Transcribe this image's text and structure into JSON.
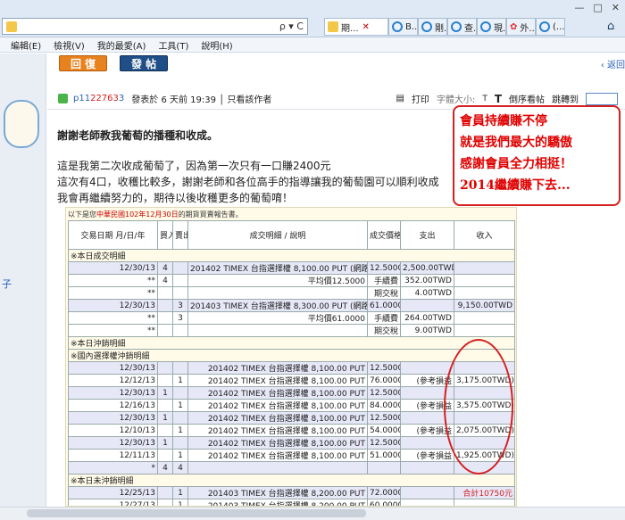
{
  "browser": {
    "address_placeholder": "",
    "addr_controls": "ρ ▾ C",
    "tabs": [
      {
        "label": "期..."
      },
      {
        "label": "B..."
      },
      {
        "label": "剛..."
      },
      {
        "label": "查..."
      },
      {
        "label": "現..."
      },
      {
        "label": "外..."
      },
      {
        "label": "(..."
      }
    ],
    "window_controls": [
      "—",
      "□",
      "✕"
    ],
    "menu": [
      "編輯(E)",
      "檢視(V)",
      "我的最愛(A)",
      "工具(T)",
      "說明(H)"
    ]
  },
  "page": {
    "reply_label": "回 復",
    "post_label": "發 帖",
    "back_label": "‹ 返回",
    "left_link": "子",
    "author_prefix": "p11",
    "author_mid": "22763",
    "author_suffix": "3",
    "meta": "發表於 6 天前 19:39 │ 只看該作者",
    "print_label": "打印",
    "fontsize_label": "字體大小:",
    "font_small": "T",
    "font_large": "T",
    "reverse_label": "倒序看帖",
    "goto_label": "跳轉到",
    "post_title": "謝謝老師教我葡萄的播種和收成。",
    "body": [
      "這是我第二次收成葡萄了，因為第一次只有一口賺2400元",
      "這次有4口，收穫比較多，謝謝老師和各位高手的指導讓我的葡萄園可以順利收成",
      "我會再繼續努力的，期待以後收穫更多的葡萄唷！"
    ],
    "callout": [
      "會員持續賺不停",
      "就是我們最大的驕傲",
      "感謝會員全力相挺！",
      "2014繼續賺下去..."
    ]
  },
  "report": {
    "caption_prefix": "以下是您",
    "caption_red": "中華民國102年12月30日",
    "caption_suffix": "的期貨買賣報告書。",
    "headers": [
      "交易日期\n月/日/年",
      "買入",
      "賣出",
      "成交明細 / 說明",
      "成交價格",
      "支出",
      "收入"
    ],
    "sec1": "※本日成交明細",
    "sec2": "※本日沖銷明細",
    "sec2b": "※國內選擇權沖銷明細",
    "sec3": "※本日未沖銷明細",
    "rows1": [
      [
        "12/30/13",
        "4",
        "",
        "201402 TIMEX 台指選擇權 8,100.00 PUT (網路)",
        "12.5000",
        "2,500.00TWD",
        ""
      ],
      [
        "**",
        "4",
        "",
        "平均價12.5000",
        "手續費",
        "352.00TWD",
        ""
      ],
      [
        "**",
        "",
        "",
        "",
        "期交稅",
        "4.00TWD",
        ""
      ],
      [
        "12/30/13",
        "",
        "3",
        "201403 TIMEX 台指選擇權 8,300.00 PUT (網路)",
        "61.0000",
        "",
        "9,150.00TWD"
      ],
      [
        "**",
        "",
        "3",
        "平均價61.0000",
        "手續費",
        "264.00TWD",
        ""
      ],
      [
        "**",
        "",
        "",
        "",
        "期交稅",
        "9.00TWD",
        ""
      ]
    ],
    "rows2": [
      [
        "12/30/13",
        "",
        "",
        "201402 TIMEX 台指選擇權 8,100.00 PUT",
        "12.5000",
        "",
        ""
      ],
      [
        "12/12/13",
        "",
        "1",
        "201402 TIMEX 台指選擇權 8,100.00 PUT",
        "76.0000",
        "(參考損益",
        "3,175.00TWD)"
      ],
      [
        "12/30/13",
        "1",
        "",
        "201402 TIMEX 台指選擇權 8,100.00 PUT",
        "12.5000",
        "",
        ""
      ],
      [
        "12/16/13",
        "",
        "1",
        "201402 TIMEX 台指選擇權 8,100.00 PUT",
        "84.0000",
        "(參考損益",
        "3,575.00TWD)"
      ],
      [
        "12/30/13",
        "1",
        "",
        "201402 TIMEX 台指選擇權 8,100.00 PUT",
        "12.5000",
        "",
        ""
      ],
      [
        "12/10/13",
        "",
        "1",
        "201402 TIMEX 台指選擇權 8,100.00 PUT",
        "54.0000",
        "(參考損益",
        "2,075.00TWD)"
      ],
      [
        "12/30/13",
        "1",
        "",
        "201402 TIMEX 台指選擇權 8,100.00 PUT",
        "12.5000",
        "",
        ""
      ],
      [
        "12/11/13",
        "",
        "1",
        "201402 TIMEX 台指選擇權 8,100.00 PUT",
        "51.0000",
        "(參考損益",
        "1,925.00TWD)"
      ],
      [
        "*",
        "4",
        "4",
        "",
        "",
        "",
        ""
      ]
    ],
    "rows3": [
      [
        "12/25/13",
        "",
        "1",
        "201403 TIMEX 台指選擇權 8,200.00 PUT",
        "72.0000",
        "",
        "合計10750元"
      ],
      [
        "12/27/13",
        "",
        "1",
        "201403 TIMEX 台指選擇權 8,200.00 PUT",
        "60.0000",
        "",
        ""
      ]
    ]
  }
}
